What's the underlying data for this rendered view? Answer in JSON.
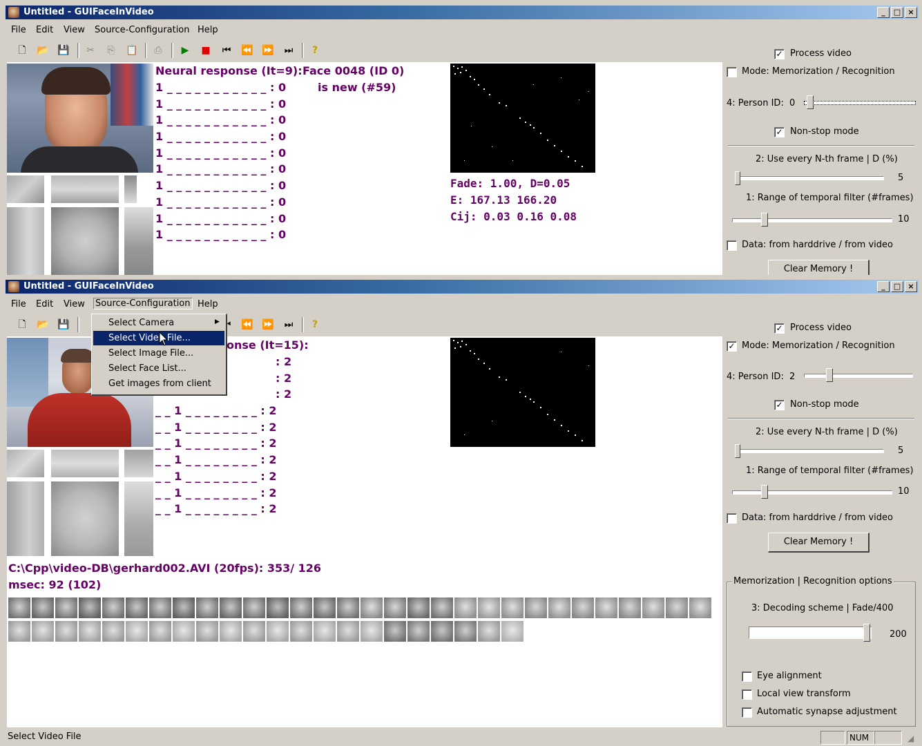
{
  "window1": {
    "title": "Untitled - GUIFaceInVideo",
    "menu": [
      "File",
      "Edit",
      "View",
      "Source-Configuration",
      "Help"
    ],
    "neural_header": "Neural response (It=9):",
    "face_label_1": "Face 0048 (ID 0)",
    "face_label_2": "is new (#59)",
    "response_rows": [
      "1 _ _ _ _ _ _ _ _ _ _ _ : 0",
      "1 _ _ _ _ _ _ _ _ _ _ _ : 0",
      "1 _ _ _ _ _ _ _ _ _ _ _ : 0",
      "1 _ _ _ _ _ _ _ _ _ _ _ : 0",
      "1 _ _ _ _ _ _ _ _ _ _ _ : 0",
      "1 _ _ _ _ _ _ _ _ _ _ _ : 0",
      "1 _ _ _ _ _ _ _ _ _ _ _ : 0",
      "1 _ _ _ _ _ _ _ _ _ _ _ : 0",
      "1 _ _ _ _ _ _ _ _ _ _ _ : 0",
      "1 _ _ _ _ _ _ _ _ _ _ _ : 0"
    ],
    "stats": [
      "Fade: 1.00, D=0.05",
      "E: 167.13 166.20",
      "Cij: 0.03 0.16 0.08"
    ],
    "panel": {
      "process_video": "Process video",
      "mode": "Mode: Memorization / Recognition",
      "person_id": "4: Person ID:",
      "person_id_value": "0",
      "non_stop": "Non-stop mode",
      "use_every": "2: Use every N-th frame | D (%)",
      "use_every_value": "5",
      "range": "1: Range of temporal filter (#frames)",
      "range_value": "10",
      "data_src": "Data: from harddrive / from video",
      "clear": "Clear Memory !"
    }
  },
  "window2": {
    "title": "Untitled - GUIFaceInVideo",
    "menu": [
      "File",
      "Edit",
      "View",
      "Source-Configuration",
      "Help"
    ],
    "neural_header_partial": "onse (It=15):",
    "response_rows": [
      ": 2",
      ": 2",
      ": 2",
      "_ _ 1 _ _ _ _ _ _ _ _ : 2",
      "_ _ 1 _ _ _ _ _ _ _ _ : 2",
      "_ _ 1 _ _ _ _ _ _ _ _ : 2",
      "_ _ 1 _ _ _ _ _ _ _ _ : 2",
      "_ _ 1 _ _ _ _ _ _ _ _ : 2",
      "_ _ 1 _ _ _ _ _ _ _ _ : 2",
      "_ _ 1 _ _ _ _ _ _ _ _ : 2"
    ],
    "file_info": "C:\\Cpp\\video-DB\\gerhard002.AVI (20fps): 353/ 126",
    "msec": "msec: 92 (102)",
    "dropdown": [
      "Select Camera",
      "Select Video File...",
      "Select Image File...",
      "Select Face List...",
      "Get images from client"
    ],
    "panel": {
      "process_video": "Process video",
      "mode": "Mode: Memorization / Recognition",
      "person_id": "4: Person ID:",
      "person_id_value": "2",
      "non_stop": "Non-stop mode",
      "use_every": "2: Use every N-th frame | D (%)",
      "use_every_value": "5",
      "range": "1: Range of temporal filter (#frames)",
      "range_value": "10",
      "data_src": "Data: from harddrive / from video",
      "clear": "Clear Memory !",
      "group_title": "Memorization | Recognition options",
      "decoding": "3: Decoding scheme | Fade/400",
      "decoding_value": "200",
      "eye_alignment": "Eye alignment",
      "local_view": "Local view transform",
      "auto_synapse": "Automatic synapse adjustment"
    },
    "status": "Select Video File",
    "status_num": "NUM"
  },
  "colors": {
    "purple_text": "#660066",
    "title_start": "#0a246a",
    "highlight": "#0a246a"
  }
}
